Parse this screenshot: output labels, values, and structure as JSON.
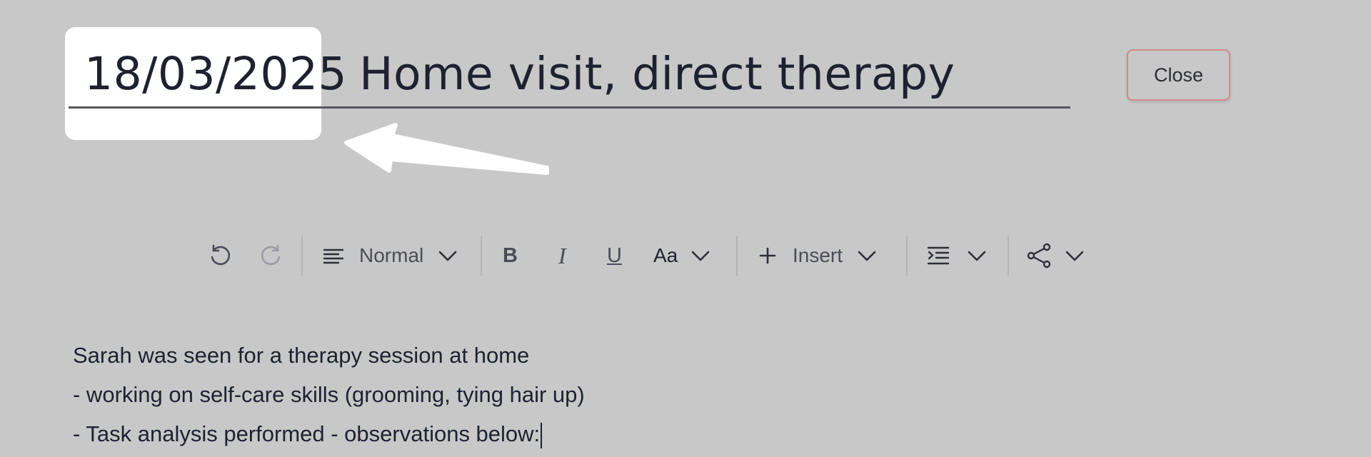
{
  "title": {
    "date": "18/03/2025",
    "text": "Home visit, direct therapy"
  },
  "close_button": {
    "label": "Close"
  },
  "toolbar": {
    "undo_icon": "undo-icon",
    "redo_icon": "redo-icon",
    "paragraph_style": "Normal",
    "bold_label": "B",
    "italic_label": "I",
    "underline_label": "U",
    "font_size_label": "Aa",
    "insert_label": "Insert"
  },
  "body": {
    "lines": [
      "Sarah was seen for a therapy session at home",
      "- working on self-care skills (grooming, tying hair up)",
      "- Task analysis performed - observations below:"
    ]
  },
  "colors": {
    "background": "#c8c8c8",
    "highlight": "#ffffff",
    "close_border": "#cf8a8a"
  }
}
